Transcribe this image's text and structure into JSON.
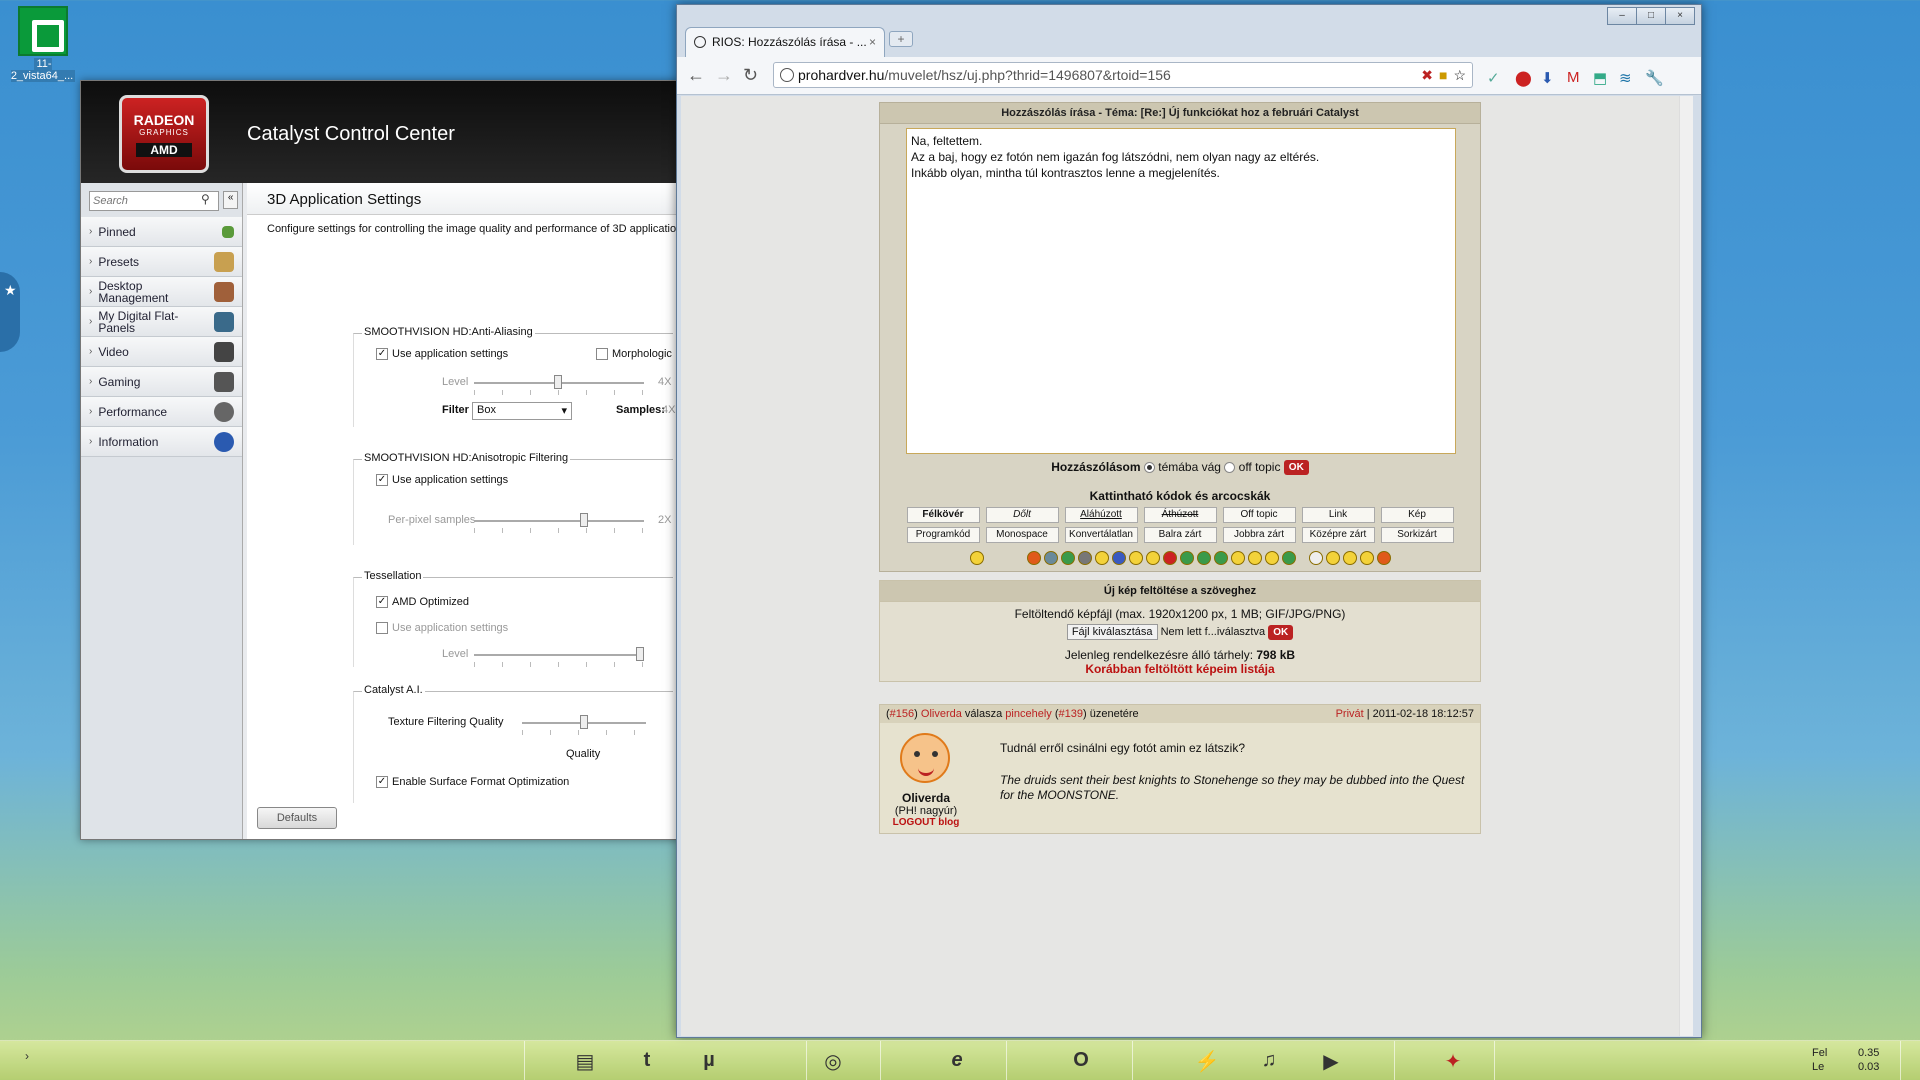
{
  "desktop": {
    "icon_label": "11-2_vista64_...",
    "side_tab_glyph": "★"
  },
  "catalyst": {
    "logo_line1": "RADEON",
    "logo_line2": "GRAPHICS",
    "logo_line3": "AMD",
    "title": "Catalyst Control Center",
    "search_placeholder": "Search",
    "nav": [
      {
        "label": "Pinned",
        "icon": "pin-icon"
      },
      {
        "label": "Presets",
        "icon": "presets-icon"
      },
      {
        "label": "Desktop Management",
        "icon": "desktop-management-icon"
      },
      {
        "label": "My Digital Flat-Panels",
        "icon": "flat-panel-icon"
      },
      {
        "label": "Video",
        "icon": "video-icon"
      },
      {
        "label": "Gaming",
        "icon": "gaming-icon"
      },
      {
        "label": "Performance",
        "icon": "performance-icon"
      },
      {
        "label": "Information",
        "icon": "information-icon"
      }
    ],
    "page_title": "3D Application Settings",
    "description": "Configure settings for controlling the image quality and performance of 3D applicatio",
    "aa": {
      "title": "SMOOTHVISION HD:Anti-Aliasing",
      "use_app": "Use application settings",
      "morph": "Morphologic",
      "level": "Level",
      "level_max": "4X",
      "filter_label": "Filter",
      "filter_value": "Box",
      "samples_label": "Samples:",
      "samples_value": "4X"
    },
    "af": {
      "title": "SMOOTHVISION HD:Anisotropic Filtering",
      "use_app": "Use application settings",
      "per_pixel": "Per-pixel samples",
      "max": "2X"
    },
    "tess": {
      "title": "Tessellation",
      "amd_opt": "AMD Optimized",
      "use_app": "Use application settings",
      "level": "Level"
    },
    "cat_ai": {
      "title": "Catalyst A.I.",
      "tex_filter": "Texture Filtering Quality",
      "quality": "Quality",
      "surface_opt": "Enable Surface Format Optimization"
    },
    "defaults_btn": "Defaults"
  },
  "browser": {
    "tab_title": "RIOS: Hozzászólás írása - ...",
    "tab_close": "×",
    "new_tab": "+",
    "url_host": "prohardver.hu",
    "url_path": "/muvelet/hsz/uj.php?thrid=1496807&rtoid=156",
    "win_min": "–",
    "win_max": "□",
    "win_close": "×"
  },
  "forum": {
    "form_title": "Hozzászólás írása - Téma: [Re:] Új funkciókat hoz a februári Catalyst",
    "post_line1": "Na, feltettem.",
    "post_line2": "Az a baj, hogy ez fotón nem igazán fog látszódni, nem olyan nagy az eltérés.",
    "post_line3": "Inkább olyan, mintha túl kontrasztos lenne a megjelenítés.",
    "post_type_label": "Hozzászólásom",
    "on_topic": "témába vág",
    "off_topic": "off topic",
    "ok": "OK",
    "codes_title": "Kattintható kódok és arcocskák",
    "codes_row1": [
      "Félkövér",
      "Dőlt",
      "Aláhúzott",
      "Áthúzott",
      "Off topic",
      "Link",
      "Kép"
    ],
    "codes_row2": [
      "Programkód",
      "Monospace",
      "Konvertálatlan",
      "Balra zárt",
      "Jobbra zárt",
      "Középre zárt",
      "Sorkizárt"
    ],
    "upload_title": "Új kép feltöltése a szöveghez",
    "upload_desc": "Feltöltendő képfájl (max. 1920x1200 px, 1 MB; GIF/JPG/PNG)",
    "file_btn": "Fájl kiválasztása",
    "no_file": "Nem lett f...iválasztva",
    "storage_label": "Jelenleg rendelkezésre álló tárhely:",
    "storage_value": "798 kB",
    "prev_uploads": "Korábban feltöltött képeim listája",
    "reply_num": "#156",
    "reply_user": "Oliverda",
    "reply_word": "válasza",
    "reply_to_user": "pincehely",
    "reply_to_num": "#139",
    "reply_suffix": "üzenetére",
    "private": "Privát",
    "timestamp": "2011-02-18 18:12:57",
    "reply_text": "Tudnál erről csinálni egy fotót amin ez látszik?",
    "signature": "The druids sent their best knights to Stonehenge so they may be dubbed into the Quest for the MOONSTONE.",
    "user_name": "Oliverda",
    "user_rank": "(PH! nagyúr)",
    "user_links": "LOGOUT blog"
  },
  "taskbar": {
    "tray_dl_label": "Fel",
    "tray_ul_label": "Le",
    "tray_dl_value": "0.35",
    "tray_ul_value": "0.03"
  },
  "colors": {
    "accent_red": "#b22222",
    "forum_bg": "#d8d4c4"
  }
}
